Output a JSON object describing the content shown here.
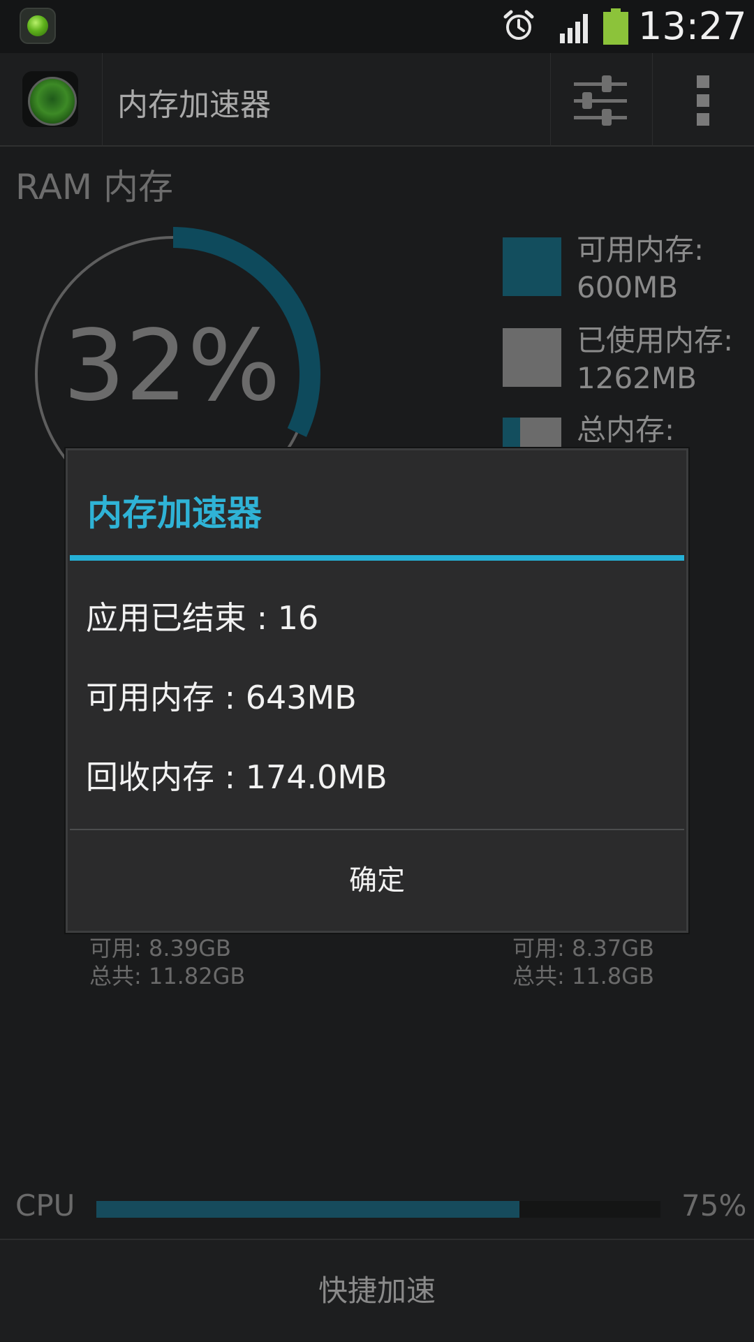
{
  "status_bar": {
    "time": "13:27",
    "icons": [
      "app-notification-icon",
      "alarm-icon",
      "signal-icon",
      "battery-icon"
    ],
    "battery_color": "#8cc33a"
  },
  "action_bar": {
    "title": "内存加速器",
    "icons": [
      "app-icon",
      "settings-sliders-icon",
      "overflow-menu-icon"
    ]
  },
  "ram": {
    "label": "RAM 内存",
    "percent": "32%",
    "usage_fraction": 0.32,
    "accent_color": "#0e4a5c",
    "legend": [
      {
        "label": "可用内存:",
        "value": "600MB",
        "color": "#134e5e"
      },
      {
        "label": "已使用内存:",
        "value": "1262MB",
        "color": "#6b6b6b"
      },
      {
        "label": "总内存:",
        "value": "",
        "color": "split"
      }
    ]
  },
  "storage": {
    "left": {
      "available": "可用: 8.39GB",
      "total": "总共: 11.82GB"
    },
    "right": {
      "available": "可用: 8.37GB",
      "total": "总共: 11.8GB"
    }
  },
  "cpu": {
    "label": "CPU",
    "value": "75%",
    "fraction": 0.75,
    "bar_color": "#164b5c"
  },
  "bottom_bar": {
    "label": "快捷加速"
  },
  "dialog": {
    "title": "内存加速器",
    "accent_color": "#25b0d6",
    "lines": [
      "应用已结束 : 16",
      "可用内存 : 643MB",
      "回收内存 : 174.0MB"
    ],
    "ok_label": "确定"
  }
}
